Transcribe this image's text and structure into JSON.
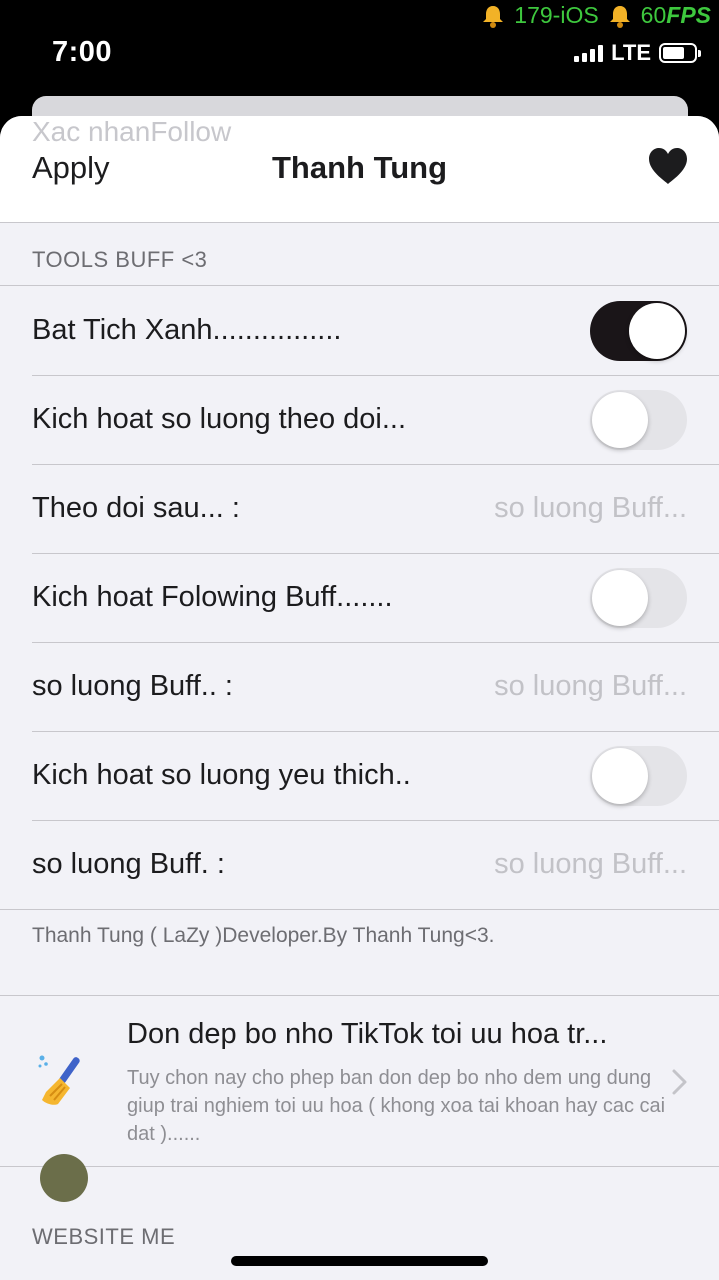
{
  "status_bar": {
    "time": "7:00",
    "network": "LTE",
    "tweak_label": "179-iOS",
    "fps_value": "60",
    "fps_suffix": "FPS",
    "fps_color": "#3ec83e"
  },
  "background_sheet": {
    "ghost_text": "Xac nhanFollow"
  },
  "navbar": {
    "left_button": "Apply",
    "title": "Thanh Tung",
    "right_icon": "heart-icon"
  },
  "tools_section": {
    "header": "TOOLS BUFF <3",
    "rows": [
      {
        "label": "Bat Tich Xanh................",
        "type": "toggle",
        "on": true
      },
      {
        "label": "Kich hoat so luong theo doi...",
        "type": "toggle",
        "on": false
      },
      {
        "label": "Theo doi sau... :",
        "type": "input",
        "placeholder": "so luong Buff..."
      },
      {
        "label": "Kich hoat Folowing Buff.......",
        "type": "toggle",
        "on": false
      },
      {
        "label": "so luong Buff.. :",
        "type": "input",
        "placeholder": "so luong Buff..."
      },
      {
        "label": "Kich hoat so luong yeu thich..",
        "type": "toggle",
        "on": false
      },
      {
        "label": "so luong Buff. :",
        "type": "input",
        "placeholder": "so luong Buff..."
      }
    ],
    "footer": "Thanh Tung ( LaZy )Developer.By Thanh Tung<3."
  },
  "cleanup": {
    "icon": "broom-icon",
    "title": "Don dep bo nho TikTok toi uu hoa tr...",
    "description": "Tuy chon nay cho phep ban don dep bo nho dem ung dung giup trai nghiem toi uu hoa ( khong xoa tai khoan hay cac cai dat )......"
  },
  "website_section": {
    "header": "WEBSITE ME"
  },
  "colors": {
    "toggle_on": "#1a1518",
    "toggle_off": "#e4e4e8",
    "background": "#f2f2f7"
  }
}
